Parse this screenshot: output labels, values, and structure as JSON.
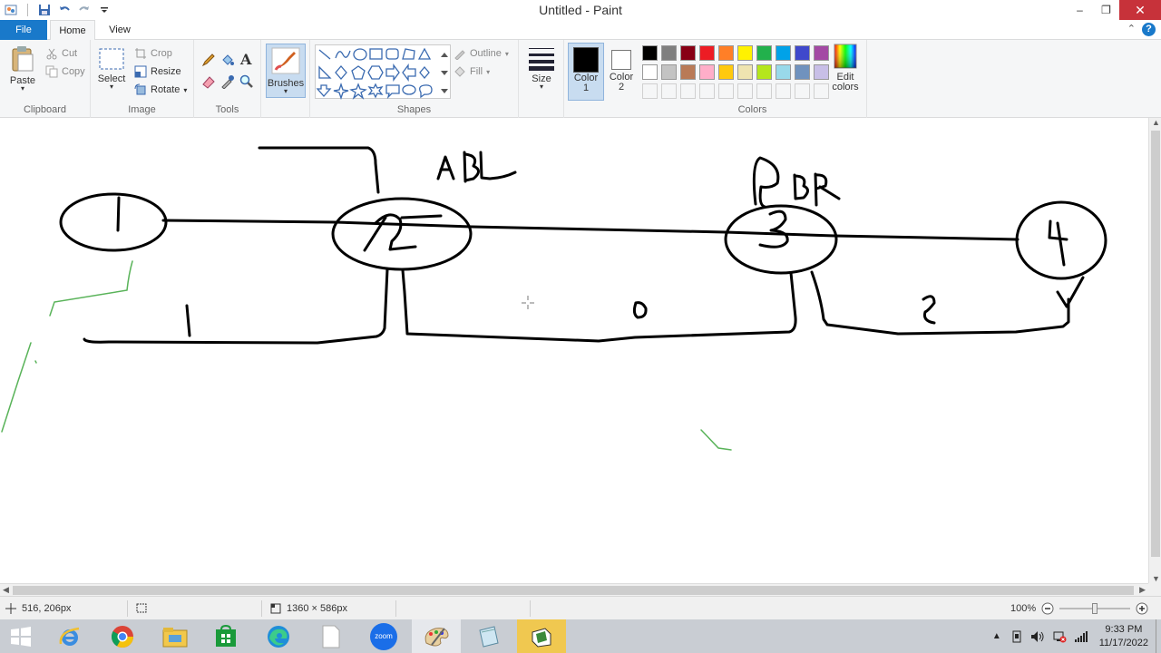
{
  "window": {
    "title": "Untitled - Paint"
  },
  "tabs": {
    "file": "File",
    "home": "Home",
    "view": "View"
  },
  "clipboard": {
    "group_label": "Clipboard",
    "paste": "Paste",
    "cut": "Cut",
    "copy": "Copy"
  },
  "image": {
    "group_label": "Image",
    "select": "Select",
    "crop": "Crop",
    "resize": "Resize",
    "rotate": "Rotate"
  },
  "tools": {
    "group_label": "Tools"
  },
  "brushes": {
    "label": "Brushes"
  },
  "shapes": {
    "group_label": "Shapes",
    "outline": "Outline",
    "fill": "Fill"
  },
  "size": {
    "label": "Size"
  },
  "color1": {
    "label": "Color",
    "sub": "1",
    "value": "#000000"
  },
  "color2": {
    "label": "Color",
    "sub": "2",
    "value": "#ffffff"
  },
  "colors": {
    "group_label": "Colors",
    "edit_label": "Edit",
    "edit_sub": "colors",
    "palette_row1": [
      "#000000",
      "#7f7f7f",
      "#880015",
      "#ed1c24",
      "#ff7f27",
      "#fff200",
      "#22b14c",
      "#00a2e8",
      "#3f48cc",
      "#a349a4"
    ],
    "palette_row2": [
      "#ffffff",
      "#c3c3c3",
      "#b97a57",
      "#ffaec9",
      "#ffc90e",
      "#efe4b0",
      "#b5e61d",
      "#99d9ea",
      "#7092be",
      "#c8bfe7"
    ]
  },
  "status": {
    "cursor_pos": "516, 206px",
    "image_size": "1360 × 586px",
    "zoom": "100%"
  },
  "taskbar": {
    "apps": [
      "start",
      "internet-explorer",
      "chrome",
      "file-explorer",
      "store",
      "edge",
      "notepad",
      "zoom",
      "paint",
      "notes",
      "paint-3d"
    ],
    "zoom_label": "zoom",
    "time": "9:33 PM",
    "date": "11/17/2022"
  },
  "drawing": {
    "node_labels": [
      "1",
      "2",
      "3",
      "4"
    ],
    "edge_labels": [
      "1",
      "0",
      "2"
    ],
    "annotations": [
      "ABL",
      "DBR"
    ]
  }
}
